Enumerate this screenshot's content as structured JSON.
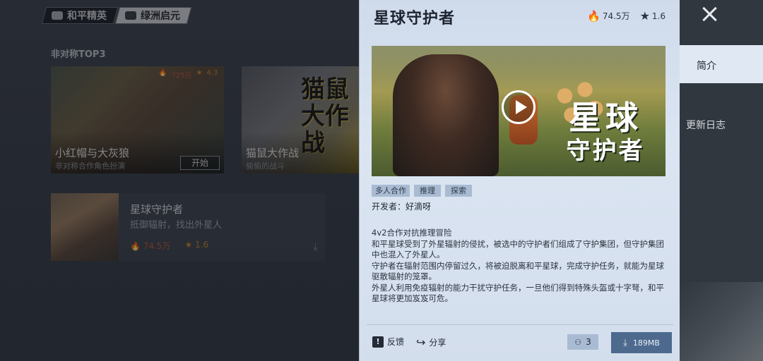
{
  "background": {
    "logos": [
      "和平精英",
      "绿洲启元"
    ],
    "section_title": "非对称TOP3",
    "cards": [
      {
        "title": "小红帽与大灰狼",
        "subtitle": "非对称合作角色扮演",
        "heat": "725万",
        "rating": "4.3",
        "button": "开始"
      },
      {
        "title": "猫鼠大作战",
        "subtitle": "偷偷的战斗",
        "art_text": "猫鼠大作战"
      }
    ],
    "list_item": {
      "title": "星球守护者",
      "subtitle": "抵御辐射，找出外星人",
      "heat": "74.5万",
      "rating": "1.6"
    }
  },
  "panel": {
    "title": "星球守护者",
    "heat": "74.5万",
    "rating": "1.6",
    "hero_art_text": {
      "line1": "星球",
      "line2": "守护者"
    },
    "tags": [
      "多人合作",
      "推理",
      "探索"
    ],
    "developer": "开发者：好滴呀",
    "description": [
      "4v2合作对抗推理冒险",
      "和平星球受到了外星辐射的侵扰，被选中的守护者们组成了守护集团，但守护集团中也混入了外星人。",
      "守护者在辐射范围内停留过久，将被迫脱离和平星球，完成守护任务，就能为星球驱散辐射的笼罩。",
      "外星人利用免疫辐射的能力干扰守护任务，一旦他们得到特殊头盔或十字弩，和平星球将更加岌岌可危。"
    ],
    "footer": {
      "feedback": "反馈",
      "share": "分享",
      "players": "3",
      "download_size": "189MB"
    }
  },
  "sidebar": {
    "tabs": [
      "简介",
      "更新日志"
    ],
    "active_tab": "简介"
  },
  "icons": {
    "heat": "flame-icon",
    "rating": "star-icon",
    "close": "close-icon",
    "play": "play-icon",
    "feedback": "feedback-icon",
    "share": "share-icon",
    "players": "group-icon",
    "download": "download-icon"
  },
  "colors": {
    "panel_bg": "#dbe5f2",
    "sidebar_bg": "#30373f",
    "download_button": "#4d6a8e",
    "tag_bg": "#a9bbd2",
    "heat_red": "#c4563f",
    "star_orange": "#c8892f"
  }
}
